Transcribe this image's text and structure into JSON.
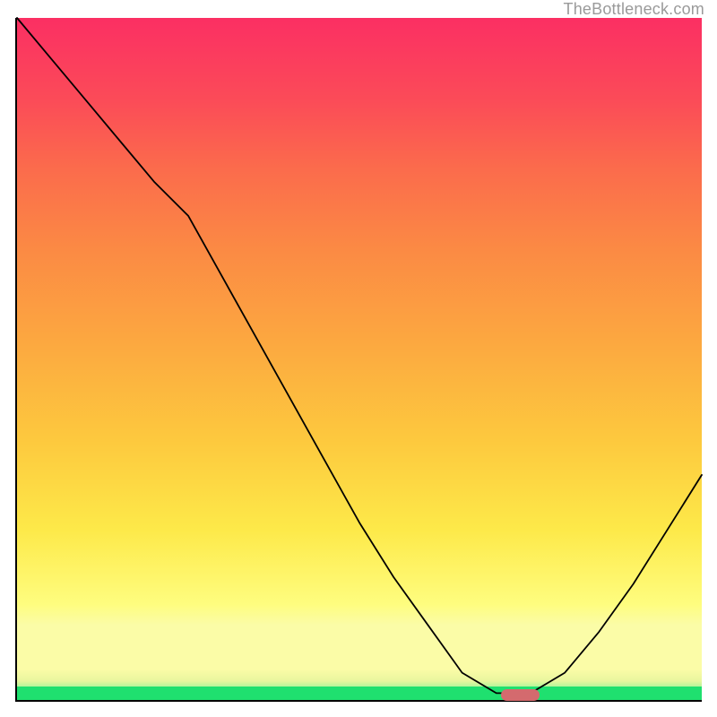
{
  "watermark": "TheBottleneck.com",
  "colors": {
    "curve": "#000000",
    "marker": "#d46a6e",
    "axis": "#000000"
  },
  "chart_data": {
    "type": "line",
    "title": "",
    "xlabel": "",
    "ylabel": "",
    "xlim": [
      0,
      100
    ],
    "ylim": [
      0,
      100
    ],
    "series": [
      {
        "name": "bottleneck-curve",
        "x": [
          0,
          5,
          10,
          15,
          20,
          25,
          30,
          35,
          40,
          45,
          50,
          55,
          60,
          65,
          70,
          72,
          75,
          80,
          85,
          90,
          95,
          100
        ],
        "y": [
          100,
          94,
          88,
          82,
          76,
          71,
          62,
          53,
          44,
          35,
          26,
          18,
          11,
          4,
          1,
          1,
          1,
          4,
          10,
          17,
          25,
          33
        ]
      }
    ],
    "marker": {
      "x_start": 70.7,
      "x_end": 76.3,
      "y": 0.8,
      "color": "#d46a6e"
    },
    "background_gradient_stops": [
      {
        "pos": 0.0,
        "color": "#1fe06f"
      },
      {
        "pos": 0.02,
        "color": "#1fe06f"
      },
      {
        "pos": 0.028,
        "color": "#e9f69e"
      },
      {
        "pos": 0.045,
        "color": "#fbfca7"
      },
      {
        "pos": 0.11,
        "color": "#fbfca7"
      },
      {
        "pos": 0.14,
        "color": "#fefd7f"
      },
      {
        "pos": 0.25,
        "color": "#fde949"
      },
      {
        "pos": 0.38,
        "color": "#fdc93e"
      },
      {
        "pos": 0.52,
        "color": "#fca940"
      },
      {
        "pos": 0.66,
        "color": "#fb8a44"
      },
      {
        "pos": 0.78,
        "color": "#fb6b4c"
      },
      {
        "pos": 0.88,
        "color": "#fb4b58"
      },
      {
        "pos": 1.0,
        "color": "#fb2f63"
      }
    ]
  }
}
